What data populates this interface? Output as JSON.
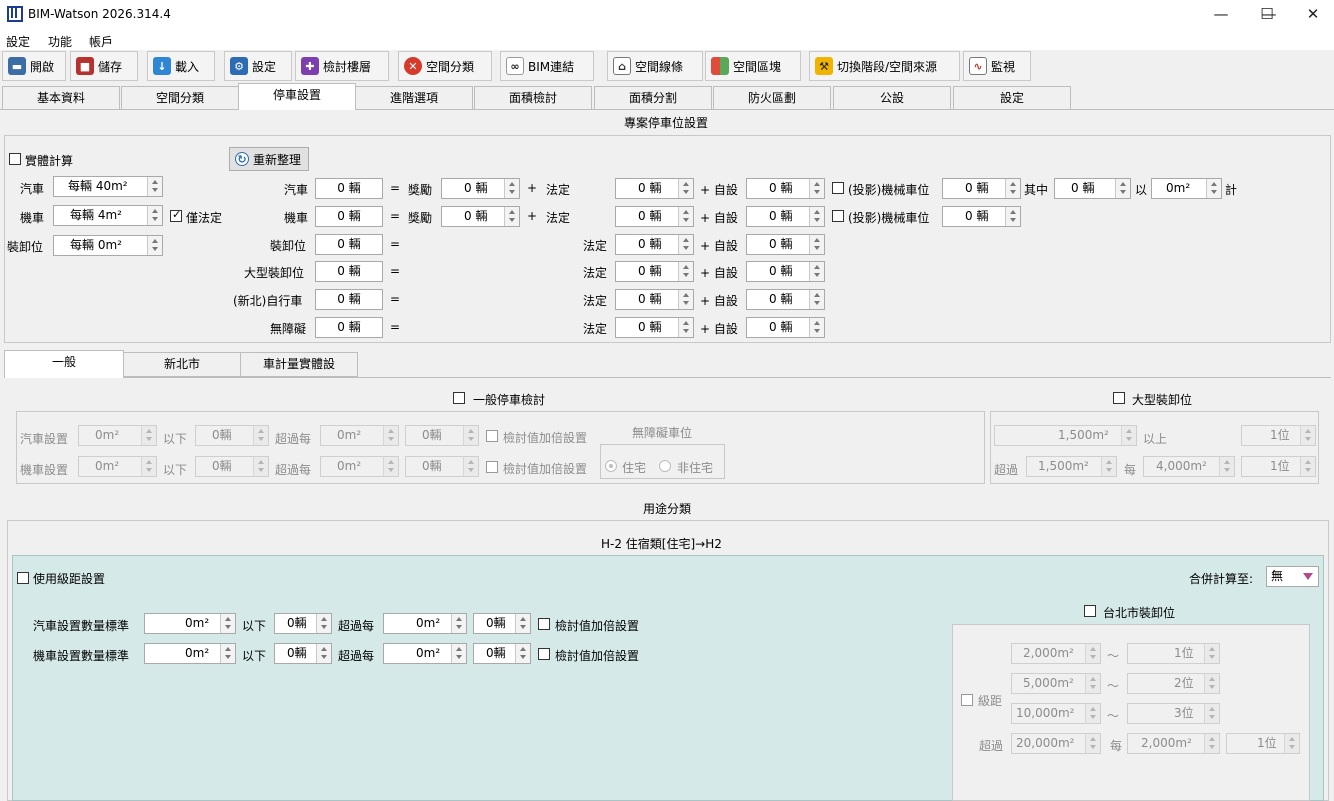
{
  "window": {
    "title": "BIM-Watson 2026.314.4",
    "minimize": "—",
    "maximize": "☐",
    "close": "✕"
  },
  "menu": [
    "設定",
    "功能",
    "帳戶"
  ],
  "toolbar": [
    {
      "label": "開啟",
      "icon": "folder-icon"
    },
    {
      "label": "儲存",
      "icon": "save-icon"
    },
    {
      "label": "載入",
      "icon": "download-icon"
    },
    {
      "label": "設定",
      "icon": "gear-icon"
    },
    {
      "label": "檢討樓層",
      "icon": "puzzle-icon"
    },
    {
      "label": "空間分類",
      "icon": "tools-icon"
    },
    {
      "label": "BIM連結",
      "icon": "link-icon"
    },
    {
      "label": "空間線條",
      "icon": "house-icon"
    },
    {
      "label": "空間區塊",
      "icon": "grid-icon"
    },
    {
      "label": "切換階段/空間來源",
      "icon": "hammer-icon"
    },
    {
      "label": "監視",
      "icon": "monitor-icon"
    }
  ],
  "tabs": [
    "基本資料",
    "空間分類",
    "停車設置",
    "進階選項",
    "面積檢討",
    "面積分割",
    "防火區劃",
    "公設",
    "設定"
  ],
  "active_tab": "停車設置",
  "project": {
    "title": "專案停車位設置",
    "physical_calc": "實體計算",
    "refresh": "重新整理",
    "left": [
      {
        "label": "汽車",
        "value": "每輛 40m²"
      },
      {
        "label": "機車",
        "value": "每輛 4m²"
      },
      {
        "label": "裝卸位",
        "value": "每輛 0m²"
      }
    ],
    "legal_only": "僅法定",
    "rows": [
      {
        "label": "汽車",
        "total": "0 輛",
        "reward_label": "獎勵",
        "reward": "0 輛",
        "legal_label": "法定",
        "legal": "0 輛",
        "self_label": "+ 自設",
        "self": "0 輛",
        "mech_label": "(投影)機械車位",
        "mech": "0 輛",
        "among_label": "其中",
        "among": "0 輛",
        "with_label": "以",
        "with": "0m²",
        "calc_label": "計"
      },
      {
        "label": "機車",
        "total": "0 輛",
        "reward_label": "獎勵",
        "reward": "0 輛",
        "legal_label": "法定",
        "legal": "0 輛",
        "self_label": "+ 自設",
        "self": "0 輛",
        "mech_label": "(投影)機械車位",
        "mech": "0 輛"
      },
      {
        "label": "裝卸位",
        "total": "0 輛",
        "legal_label": "法定",
        "legal": "0 輛",
        "self_label": "+ 自設",
        "self": "0 輛"
      },
      {
        "label": "大型裝卸位",
        "total": "0 輛",
        "legal_label": "法定",
        "legal": "0 輛",
        "self_label": "+ 自設",
        "self": "0 輛"
      },
      {
        "label": "(新北)自行車",
        "total": "0 輛",
        "legal_label": "法定",
        "legal": "0 輛",
        "self_label": "+ 自設",
        "self": "0 輛"
      },
      {
        "label": "無障礙",
        "total": "0 輛",
        "legal_label": "法定",
        "legal": "0 輛",
        "self_label": "+ 自設",
        "self": "0 輛"
      }
    ],
    "eq": "=",
    "plus": "+"
  },
  "subtabs": [
    "一般",
    "新北市",
    "車計量實體設"
  ],
  "general": {
    "title": "一般停車檢討",
    "car_label": "汽車設置",
    "moto_label": "機車設置",
    "below": "以下",
    "per": "超過每",
    "car": {
      "area": "0m²",
      "cnt": "0輛",
      "per_area": "0m²",
      "per_cnt": "0輛"
    },
    "moto": {
      "area": "0m²",
      "cnt": "0輛",
      "per_area": "0m²",
      "per_cnt": "0輛"
    },
    "double": "檢討值加倍設置",
    "accessible_title": "無障礙車位",
    "residential": "住宅",
    "nonresidential": "非住宅"
  },
  "large": {
    "title": "大型裝卸位",
    "r1_area": "1,500m²",
    "r1_label": "以上",
    "r1_cnt": "1位",
    "r2_label": "超過",
    "r2_area": "1,500m²",
    "r2_per": "每",
    "r2_area2": "4,000m²",
    "r2_cnt": "1位"
  },
  "use": {
    "title": "用途分類",
    "heading": "H-2 住宿類[住宅]→H2",
    "grade": "使用級距設置",
    "merge_label": "合併計算至:",
    "merge_value": "無",
    "car_label": "汽車設置數量標準",
    "moto_label": "機車設置數量標準",
    "below": "以下",
    "per": "超過每",
    "car": {
      "area": "0m²",
      "cnt": "0輛",
      "per_area": "0m²",
      "per_cnt": "0輛"
    },
    "moto": {
      "area": "0m²",
      "cnt": "0輛",
      "per_area": "0m²",
      "per_cnt": "0輛"
    },
    "double": "檢討值加倍設置",
    "taipei": {
      "title": "台北市裝卸位",
      "grade_label": "級距",
      "tilde": "～",
      "rows": [
        {
          "area": "2,000m²",
          "cnt": "1位"
        },
        {
          "area": "5,000m²",
          "cnt": "2位"
        },
        {
          "area": "10,000m²",
          "cnt": "3位"
        }
      ],
      "over_label": "超過",
      "over_area": "20,000m²",
      "per": "每",
      "per_area": "2,000m²",
      "per_cnt": "1位"
    }
  }
}
